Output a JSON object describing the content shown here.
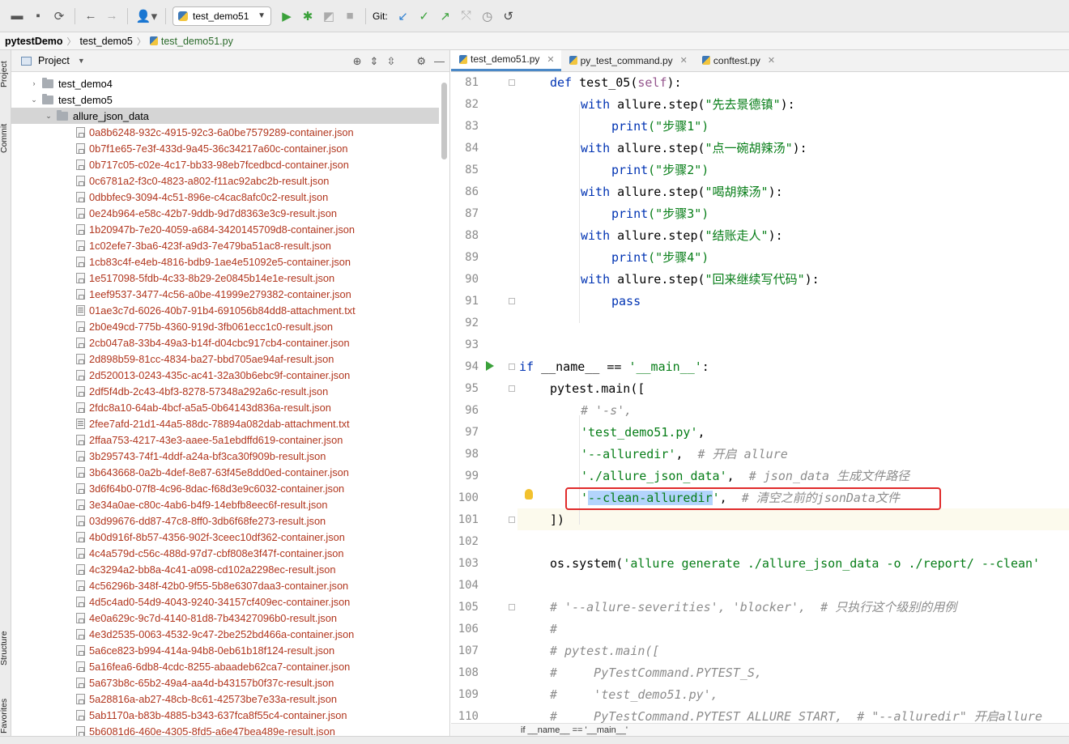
{
  "window_title": "pytestDemo – test_demo51.py",
  "toolbar": {
    "run_config": "test_demo51",
    "git_label": "Git:"
  },
  "breadcrumb": [
    "pytestDemo",
    "test_demo5",
    "test_demo51.py"
  ],
  "side_tabs": {
    "project": "Project",
    "commit": "Commit",
    "structure": "Structure",
    "favorites": "Favorites"
  },
  "project_panel": {
    "title": "Project",
    "folders": [
      "test_demo4",
      "test_demo5",
      "allure_json_data"
    ],
    "files": [
      "0a8b6248-932c-4915-92c3-6a0be7579289-container.json",
      "0b7f1e65-7e3f-433d-9a45-36c34217a60c-container.json",
      "0b717c05-c02e-4c17-bb33-98eb7fcedbcd-container.json",
      "0c6781a2-f3c0-4823-a802-f11ac92abc2b-result.json",
      "0dbbfec9-3094-4c51-896e-c4cac8afc0c2-result.json",
      "0e24b964-e58c-42b7-9ddb-9d7d8363e3c9-result.json",
      "1b20947b-7e20-4059-a684-3420145709d8-container.json",
      "1c02efe7-3ba6-423f-a9d3-7e479ba51ac8-result.json",
      "1cb83c4f-e4eb-4816-bdb9-1ae4e51092e5-container.json",
      "1e517098-5fdb-4c33-8b29-2e0845b14e1e-result.json",
      "1eef9537-3477-4c56-a0be-41999e279382-container.json",
      "01ae3c7d-6026-40b7-91b4-691056b84dd8-attachment.txt",
      "2b0e49cd-775b-4360-919d-3fb061ecc1c0-result.json",
      "2cb047a8-33b4-49a3-b14f-d04cbc917cb4-container.json",
      "2d898b59-81cc-4834-ba27-bbd705ae94af-result.json",
      "2d520013-0243-435c-ac41-32a30b6ebc9f-container.json",
      "2df5f4db-2c43-4bf3-8278-57348a292a6c-result.json",
      "2fdc8a10-64ab-4bcf-a5a5-0b64143d836a-result.json",
      "2fee7afd-21d1-44a5-88dc-78894a082dab-attachment.txt",
      "2ffaa753-4217-43e3-aaee-5a1ebdffd619-container.json",
      "3b295743-74f1-4ddf-a24a-bf3ca30f909b-result.json",
      "3b643668-0a2b-4def-8e87-63f45e8dd0ed-container.json",
      "3d6f64b0-07f8-4c96-8dac-f68d3e9c6032-container.json",
      "3e34a0ae-c80c-4ab6-b4f9-14ebfb8eec6f-result.json",
      "03d99676-dd87-47c8-8ff0-3db6f68fe273-result.json",
      "4b0d916f-8b57-4356-902f-3ceec10df362-container.json",
      "4c4a579d-c56c-488d-97d7-cbf808e3f47f-container.json",
      "4c3294a2-bb8a-4c41-a098-cd102a2298ec-result.json",
      "4c56296b-348f-42b0-9f55-5b8e6307daa3-container.json",
      "4d5c4ad0-54d9-4043-9240-34157cf409ec-container.json",
      "4e0a629c-9c7d-4140-81d8-7b43427096b0-result.json",
      "4e3d2535-0063-4532-9c47-2be252bd466a-container.json",
      "5a6ce823-b994-414a-94b8-0eb61b18f124-result.json",
      "5a16fea6-6db8-4cdc-8255-abaadeb62ca7-container.json",
      "5a673b8c-65b2-49a4-aa4d-b43157b0f37c-result.json",
      "5a28816a-ab27-48cb-8c61-42573be7e33a-result.json",
      "5ab1170a-b83b-4885-b343-637fca8f55c4-container.json",
      "5b6081d6-460e-4305-8fd5-a6e47bea489e-result.json"
    ]
  },
  "editor": {
    "tabs": [
      "test_demo51.py",
      "py_test_command.py",
      "conftest.py"
    ],
    "line_numbers": [
      "81",
      "82",
      "83",
      "84",
      "85",
      "86",
      "87",
      "88",
      "89",
      "90",
      "91",
      "92",
      "93",
      "94",
      "95",
      "96",
      "97",
      "98",
      "99",
      "100",
      "101",
      "102",
      "103",
      "104",
      "105",
      "106",
      "107",
      "108",
      "109",
      "110"
    ],
    "code": {
      "l81_kw": "def",
      "l81_name": " test_05(",
      "l81_self": "self",
      "l81_end": "):",
      "with": "with",
      "allure_step": " allure.step(",
      "close_colon": "):",
      "print": "print",
      "pass": "pass",
      "s82": "\"先去景德镇\"",
      "s83": "(\"步骤1\")",
      "s84": "\"点一碗胡辣汤\"",
      "s85": "(\"步骤2\")",
      "s86": "\"喝胡辣汤\"",
      "s87": "(\"步骤3\")",
      "s88": "\"结账走人\"",
      "s89": "(\"步骤4\")",
      "s90": "\"回来继续写代码\"",
      "l94_if": "if",
      "l94_mid": " __name__ == ",
      "l94_str": "'__main__'",
      "l94_end": ":",
      "l95": "pytest.main([",
      "l96": "# '-s',",
      "l97": "'test_demo51.py'",
      "l98_str": "'--alluredir'",
      "l98_cmt": "# 开启 allure",
      "l99_str": "'./allure_json_data'",
      "l99_cmt": "# json_data 生成文件路径",
      "l100_q1": "'",
      "l100_sel": "--clean-alluredir",
      "l100_q2": "'",
      "l100_cmt": "# 清空之前的jsonData文件",
      "l101": "])",
      "l103_a": "os.system(",
      "l103_str": "'allure generate ./allure_json_data -o ./report/ --clean'",
      "l105": "# '--allure-severities', 'blocker',  # 只执行这个级别的用例",
      "l106": "#",
      "l107": "# pytest.main([",
      "l108": "#     PyTestCommand.PYTEST_S,",
      "l109": "#     'test_demo51.py',",
      "l110": "#     PyTestCommand.PYTEST_ALLURE_START,  # \"--alluredir\" 开启allure"
    },
    "status_crumb": "if __name__ == '__main__'"
  }
}
